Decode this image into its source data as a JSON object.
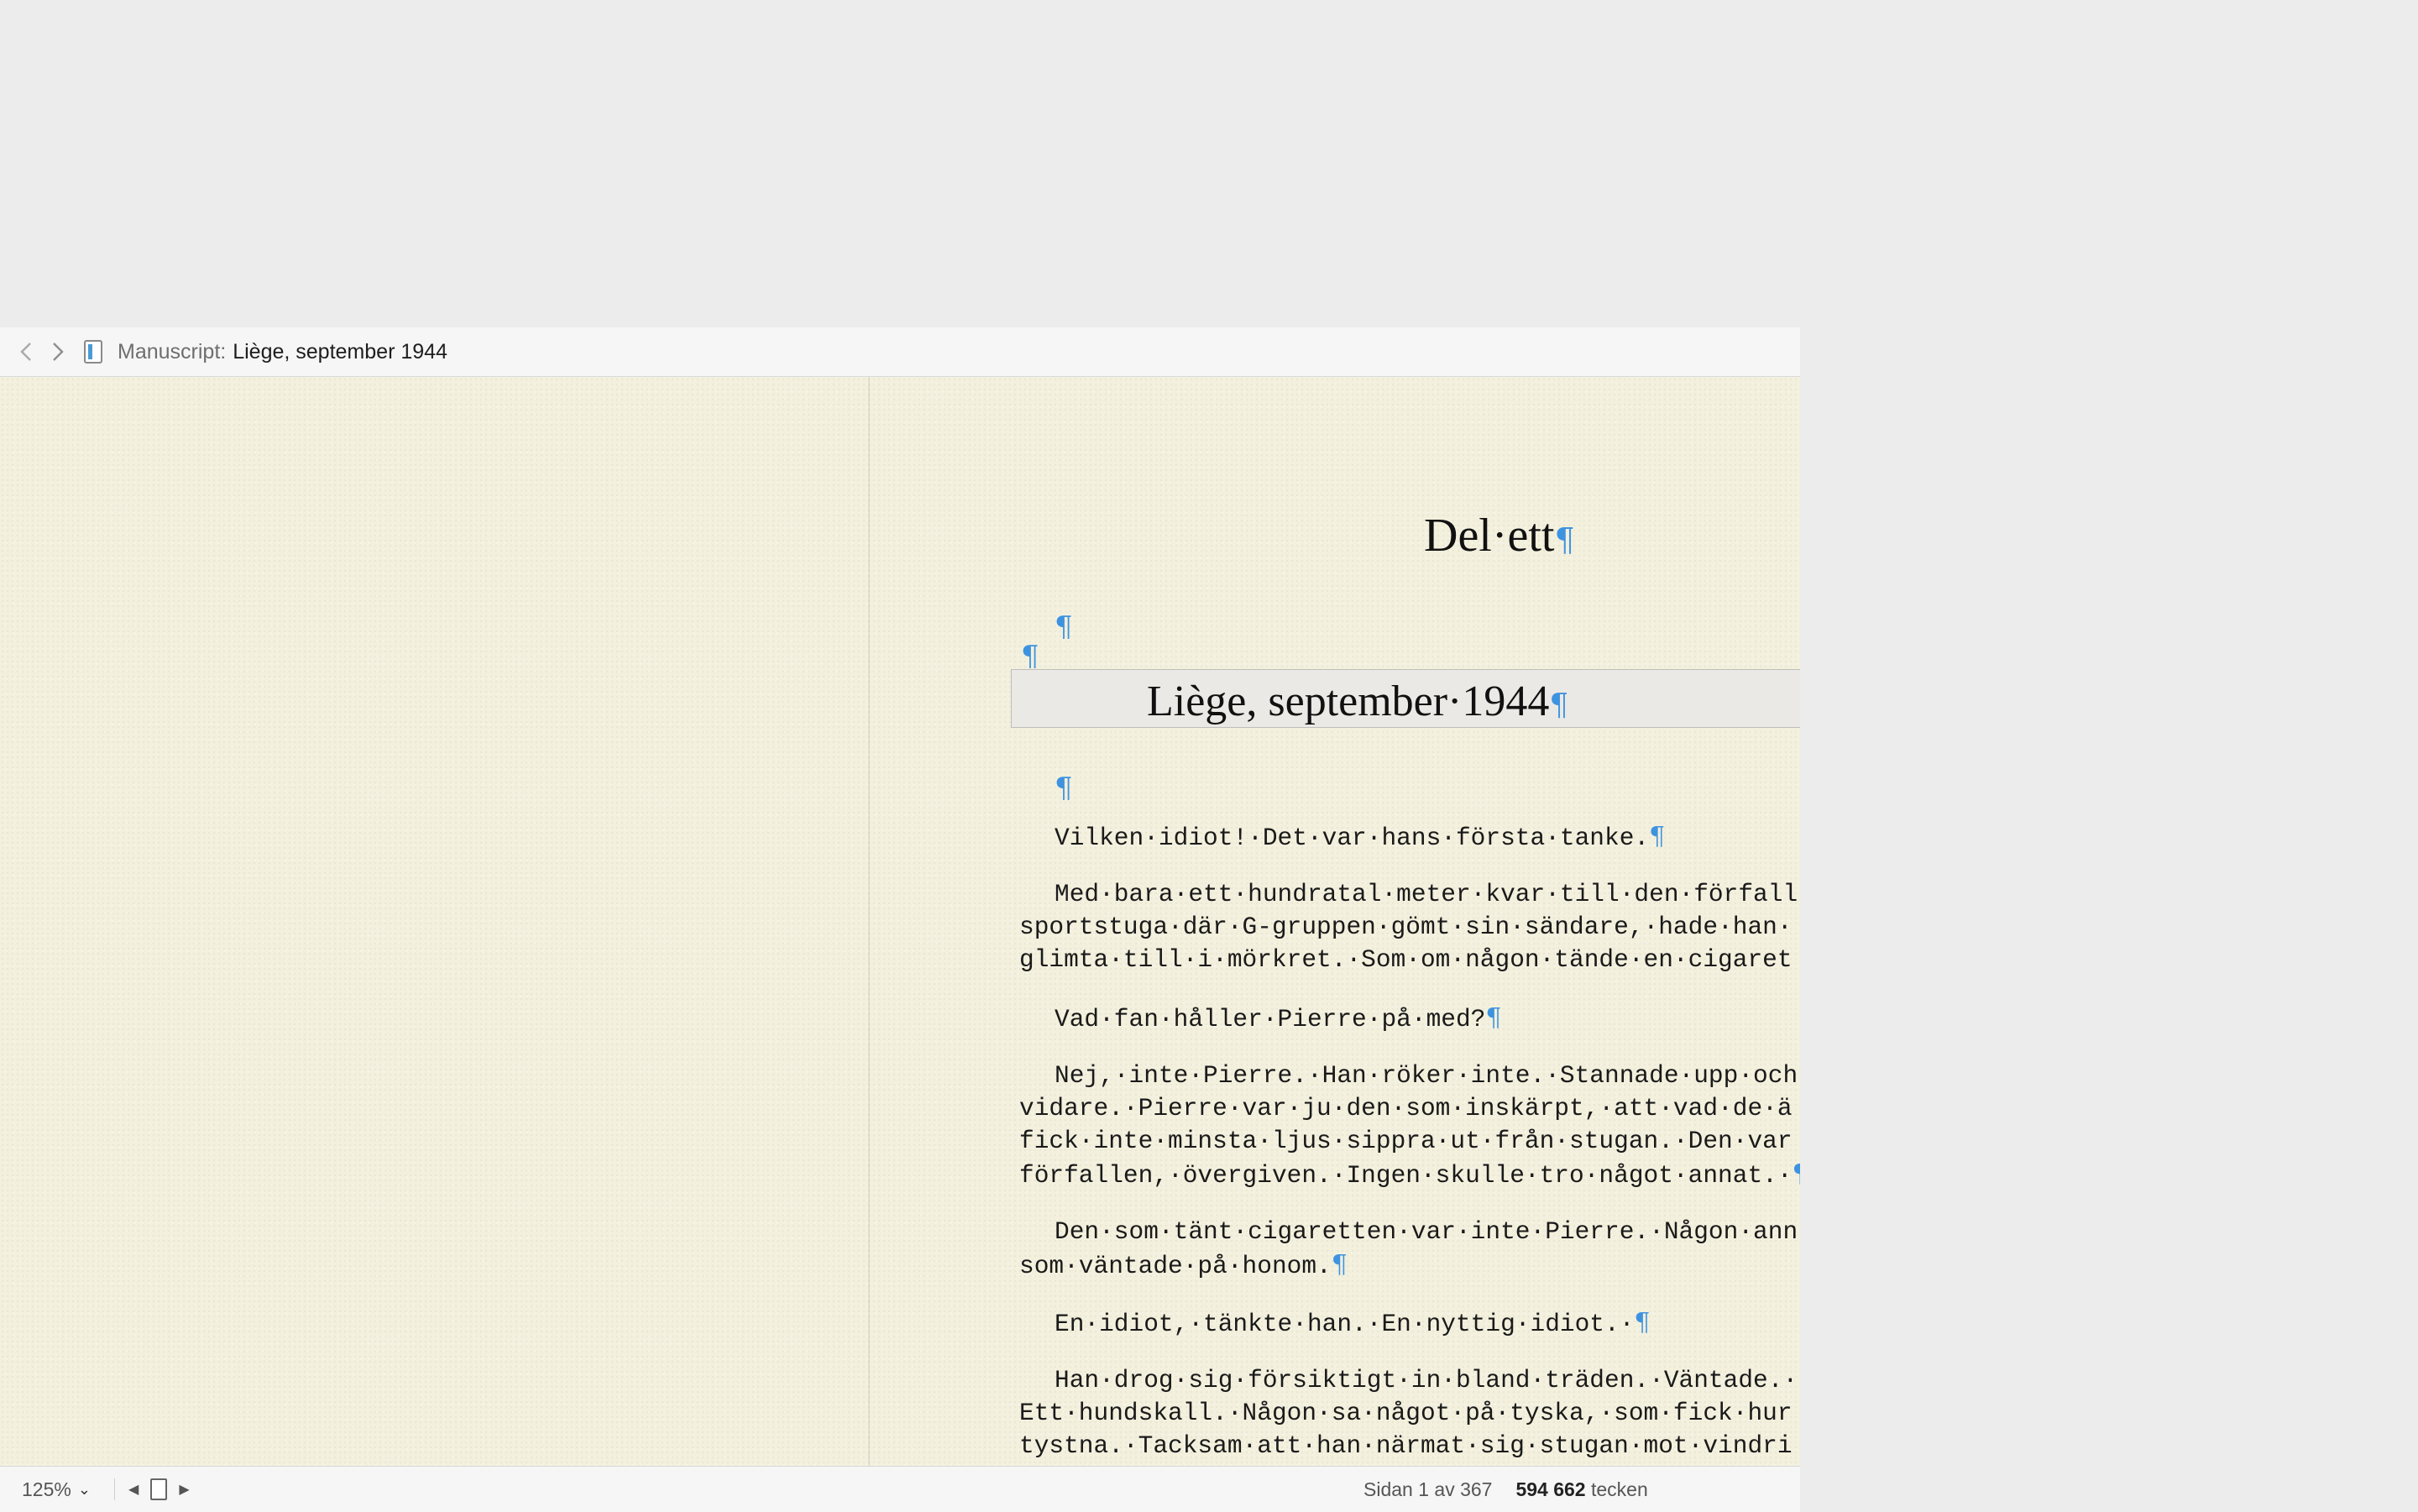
{
  "header": {
    "back_icon": "chevron-left-icon",
    "forward_icon": "chevron-right-icon",
    "doc_icon": "document-icon",
    "label": "Manuscript:",
    "title": "Liège, september 1944"
  },
  "document": {
    "pilcrow": "¶",
    "part_title": "Del·ett",
    "chapter_title": "Liège, september·1944",
    "paragraphs": [
      {
        "lines": [
          "Vilken·idiot!·Det·var·hans·första·tanke."
        ],
        "end": true
      },
      {
        "lines": [
          "Med·bara·ett·hundratal·meter·kvar·till·den·förfall",
          "sportstuga·där·G-gruppen·gömt·sin·sändare,·hade·han·",
          "glimta·till·i·mörkret.·Som·om·någon·tände·en·cigaret"
        ],
        "end": false
      },
      {
        "lines": [
          "Vad·fan·håller·Pierre·på·med?"
        ],
        "end": true
      },
      {
        "lines": [
          "Nej,·inte·Pierre.·Han·röker·inte.·Stannade·upp·och",
          "vidare.·Pierre·var·ju·den·som·inskärpt,·att·vad·de·ä",
          "fick·inte·minsta·ljus·sippra·ut·från·stugan.·Den·var",
          "förfallen,·övergiven.·Ingen·skulle·tro·något·annat.·"
        ],
        "end": true
      },
      {
        "lines": [
          "Den·som·tänt·cigaretten·var·inte·Pierre.·Någon·ann",
          "som·väntade·på·honom."
        ],
        "end": true
      },
      {
        "lines": [
          "En·idiot,·tänkte·han.·En·nyttig·idiot.·"
        ],
        "end": true
      },
      {
        "lines": [
          "Han·drog·sig·försiktigt·in·bland·träden.·Väntade.·",
          "Ett·hundskall.·Någon·sa·något·på·tyska,·som·fick·hur",
          "tystna.·Tacksam·att·han·närmat·sig·stugan·mot·vindri"
        ],
        "end": false
      }
    ]
  },
  "status": {
    "zoom": "125%",
    "zoom_chevron_icon": "chevron-down-icon",
    "prev_icon": "triangle-left-icon",
    "page_icon": "page-icon",
    "next_icon": "triangle-right-icon",
    "page_info": "Sidan 1 av 367",
    "char_count": "594 662",
    "char_label": "tecken"
  },
  "colors": {
    "paper": "#f3f0dd",
    "pilcrow": "#3d93e0",
    "chapter_bar": "#ebe9e5"
  }
}
